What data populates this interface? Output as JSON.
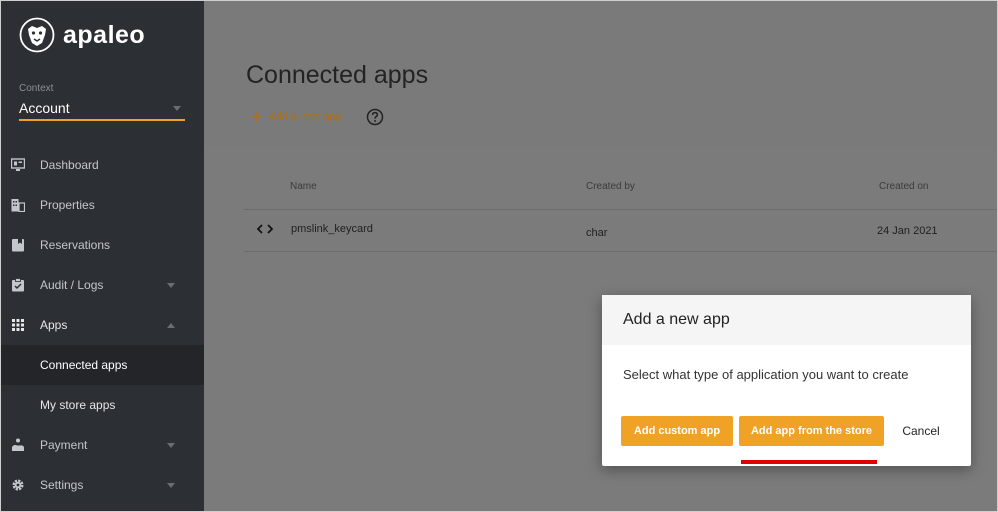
{
  "brand": {
    "name": "apaleo"
  },
  "context": {
    "label": "Context",
    "value": "Account"
  },
  "nav": {
    "dashboard": "Dashboard",
    "properties": "Properties",
    "reservations": "Reservations",
    "audit_logs": "Audit / Logs",
    "apps": "Apps",
    "connected_apps": "Connected apps",
    "my_store_apps": "My store apps",
    "payment": "Payment",
    "settings": "Settings"
  },
  "page": {
    "title": "Connected apps",
    "add_link": "Add a new app"
  },
  "table": {
    "headers": {
      "name": "Name",
      "created_by": "Created by",
      "created_on": "Created on"
    },
    "rows": [
      {
        "name": "pmslink_keycard",
        "created_by": "char",
        "created_on": "24 Jan 2021"
      }
    ]
  },
  "dialog": {
    "title": "Add a new app",
    "body": "Select what type of application you want to create",
    "btn_custom": "Add custom app",
    "btn_store": "Add app from the store",
    "btn_cancel": "Cancel"
  },
  "colors": {
    "accent": "#f0a227",
    "sidebar": "#2c2f33",
    "highlight": "#e00000"
  },
  "icons": [
    "lion-logo-icon",
    "chevron-down-icon",
    "chevron-up-icon",
    "dashboard-icon",
    "properties-icon",
    "reservations-icon",
    "audit-icon",
    "apps-grid-icon",
    "payment-icon",
    "gear-icon",
    "plus-icon",
    "help-icon",
    "code-icon"
  ]
}
